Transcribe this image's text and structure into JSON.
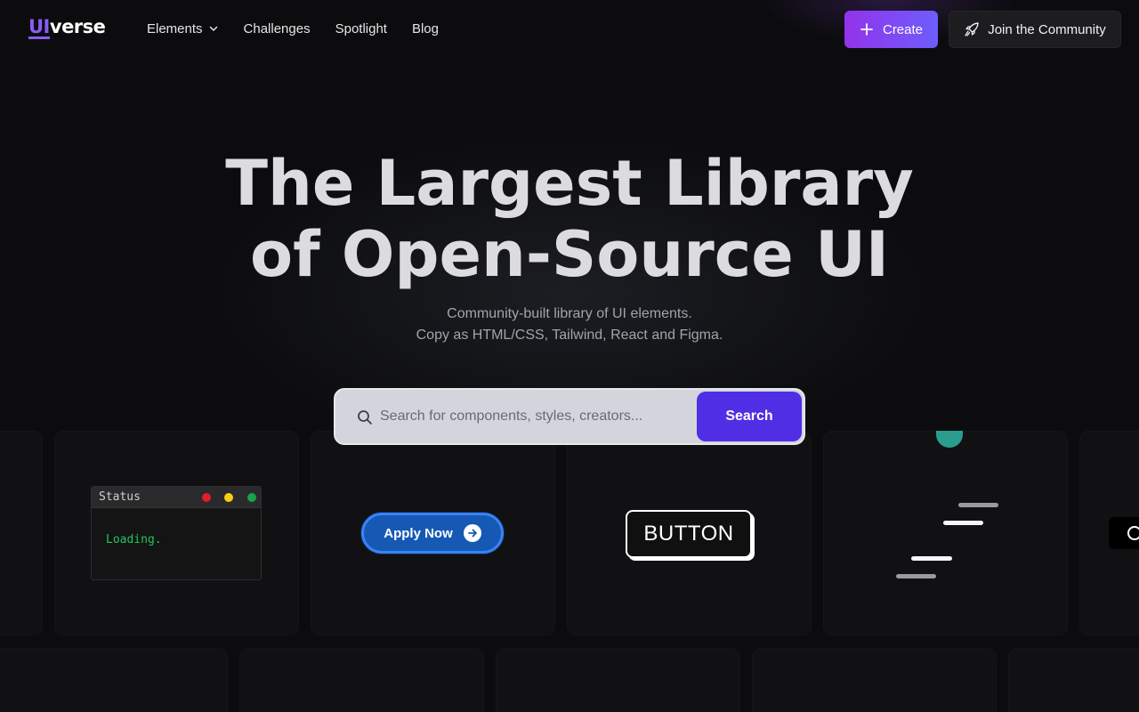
{
  "header": {
    "logo": {
      "part1": "UI",
      "part2": "verse"
    },
    "nav": [
      {
        "label": "Elements",
        "has_dropdown": true,
        "icon": "chevron-down-icon"
      },
      {
        "label": "Challenges"
      },
      {
        "label": "Spotlight"
      },
      {
        "label": "Blog"
      }
    ],
    "create_label": "Create",
    "create_icon": "plus-icon",
    "join_label": "Join the Community",
    "join_icon": "rocket-icon"
  },
  "hero": {
    "title_line1": "The Largest Library",
    "title_line2": "of Open-Source UI",
    "subtitle_line1": "Community-built library of UI elements.",
    "subtitle_line2": "Copy as HTML/CSS, Tailwind, React and Figma."
  },
  "search": {
    "placeholder": "Search for components, styles, creators...",
    "value": "",
    "button_label": "Search",
    "icon": "search-icon"
  },
  "showcase": {
    "status_window": {
      "title": "Status",
      "body": "Loading.",
      "dot_colors": [
        "#e11d2a",
        "#facc15",
        "#16a34a"
      ]
    },
    "apply_button": {
      "label": "Apply Now",
      "icon": "arrow-right-circle-icon"
    },
    "plain_button": {
      "label": "BUTTON"
    }
  },
  "colors": {
    "background": "#0c0c0e",
    "accent_purple": "#8b5cf6",
    "search_button": "#4f2ee6",
    "apply_blue": "#1559b5",
    "loader_teal": "#2a9d8f",
    "terminal_green": "#22c55e"
  }
}
